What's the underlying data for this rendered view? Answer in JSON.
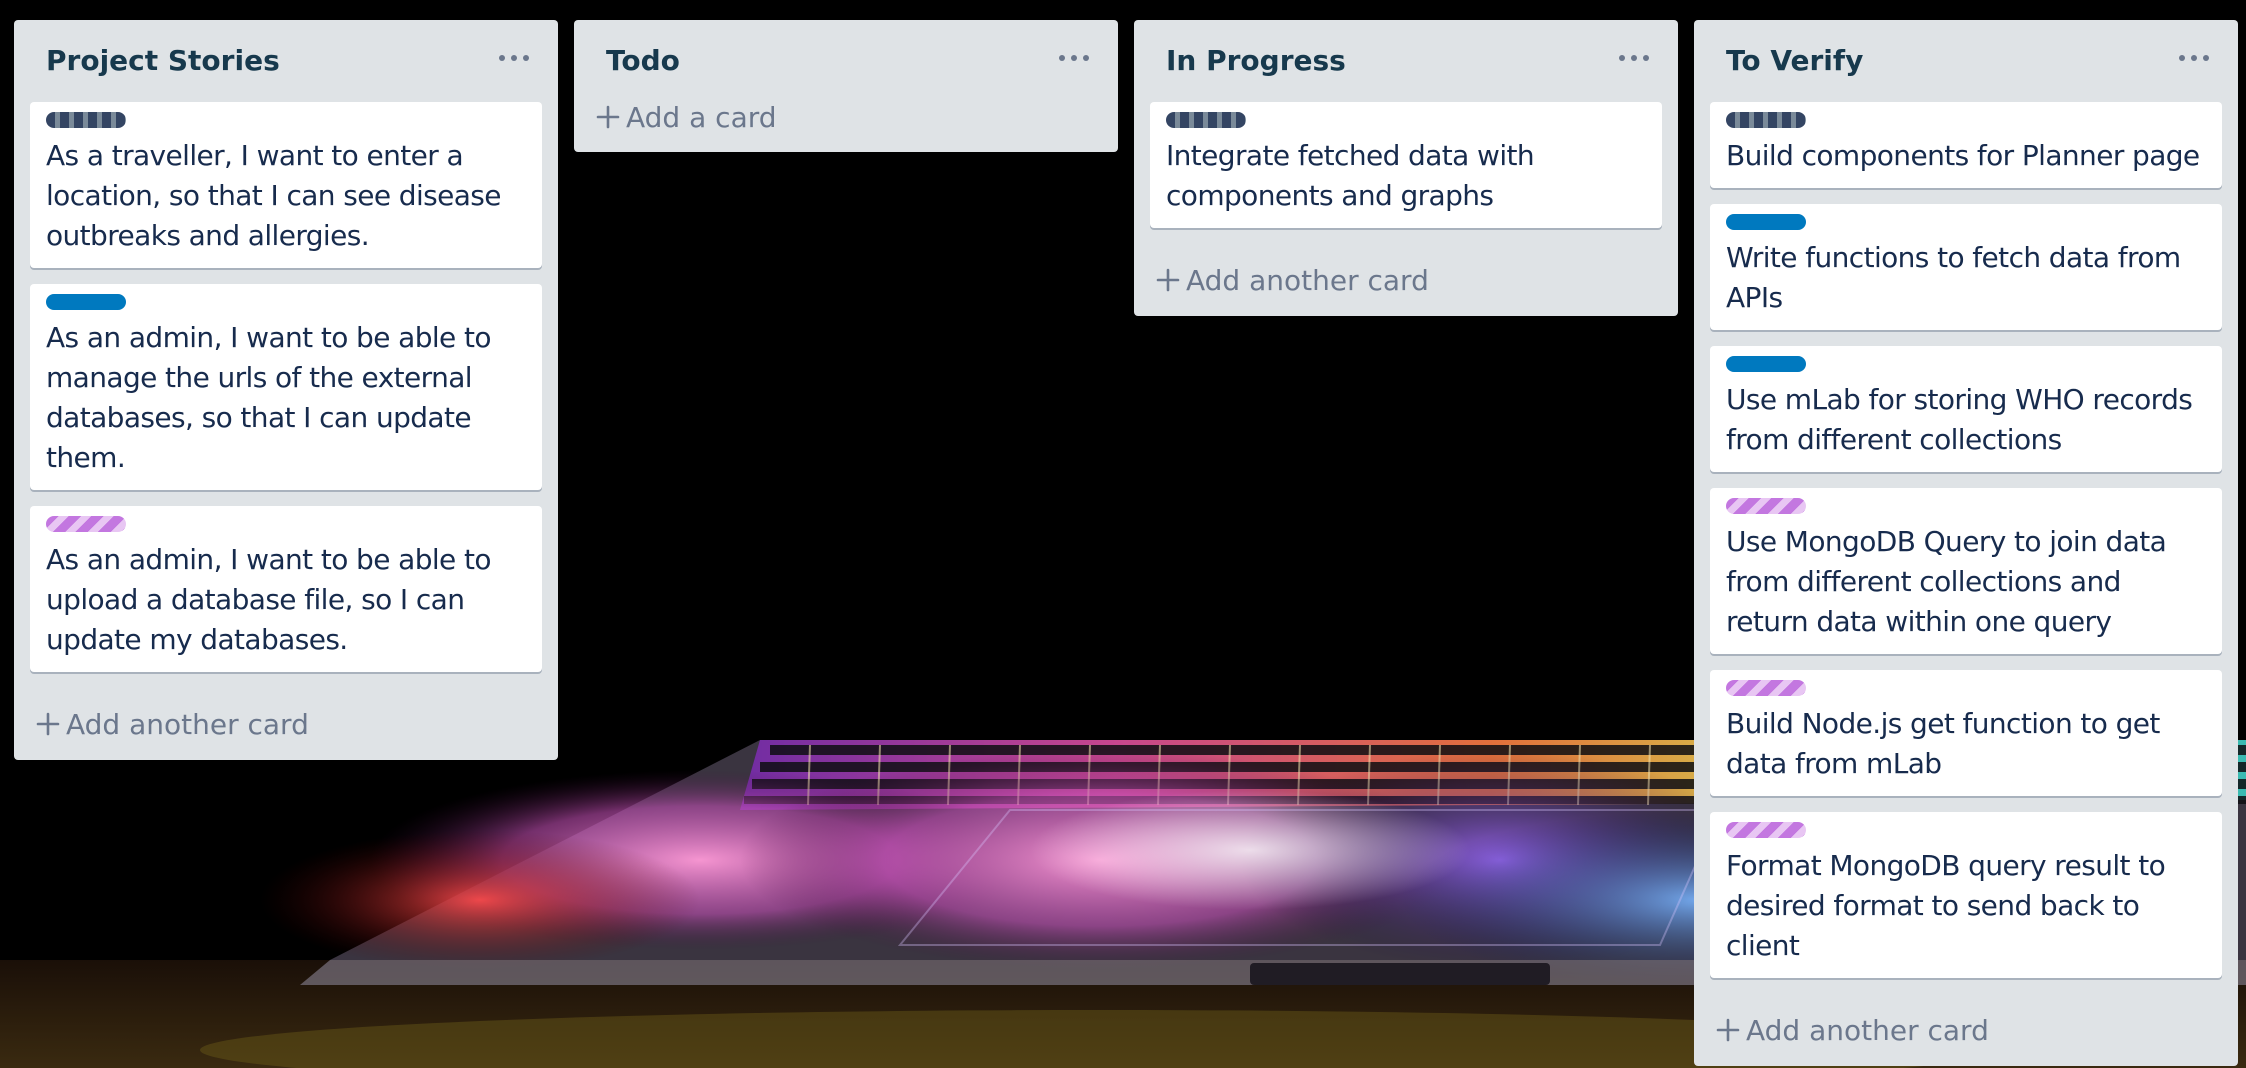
{
  "lists": [
    {
      "title": "Project Stories",
      "menu_icon": "ellipsis-icon",
      "add_label": "Add another card",
      "cards": [
        {
          "label_color": "#344563",
          "text": "As a traveller, I want to enter a location, so that I can see disease outbreaks and allergies."
        },
        {
          "label_color": "#0079bf",
          "text": "As an admin, I want to be able to manage the urls of the external databases, so that I can update them."
        },
        {
          "label_color": "#c377e0",
          "text": "As an admin, I want to be able to upload a database file, so I can update my databases."
        }
      ]
    },
    {
      "title": "Todo",
      "menu_icon": "ellipsis-icon",
      "add_label": "Add a card",
      "cards": []
    },
    {
      "title": "In Progress",
      "menu_icon": "ellipsis-icon",
      "add_label": "Add another card",
      "cards": [
        {
          "label_color": "#344563",
          "text": "Integrate fetched data with components and graphs"
        }
      ]
    },
    {
      "title": "To Verify",
      "menu_icon": "ellipsis-icon",
      "add_label": "Add another card",
      "cards": [
        {
          "label_color": "#344563",
          "text": "Build components for Planner page"
        },
        {
          "label_color": "#0079bf",
          "text": "Write functions to fetch data from APIs"
        },
        {
          "label_color": "#0079bf",
          "text": "Use mLab for storing WHO records from different collections"
        },
        {
          "label_color": "#c377e0",
          "text": "Use MongoDB Query to join data from different collections and return data within one query"
        },
        {
          "label_color": "#c377e0",
          "text": "Build Node.js get function to get data from mLab"
        },
        {
          "label_color": "#c377e0",
          "text": "Format MongoDB query result to desired format to send back to client"
        }
      ]
    }
  ],
  "colors": {
    "list_bg": "#dfe3e6",
    "title_text": "#17394d",
    "card_text": "#172b4d",
    "muted_text": "#6b778c"
  }
}
